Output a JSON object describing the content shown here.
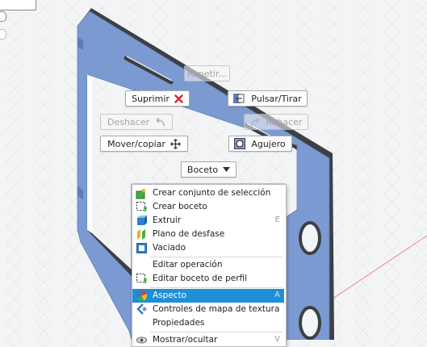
{
  "marking_menu": {
    "repeat": "Repetir...",
    "delete": "Suprimir",
    "push_pull": "Pulsar/Tirar",
    "undo": "Deshacer",
    "redo": "Rehacer",
    "move_copy": "Mover/copiar",
    "hole": "Agujero",
    "sketch": "Boceto"
  },
  "context_menu": {
    "create_selection_set": "Crear conjunto de selección",
    "create_sketch": "Crear boceto",
    "extrude": {
      "label": "Extruir",
      "shortcut": "E"
    },
    "offset_plane": "Plano de desfase",
    "shell": "Vaciado",
    "edit_feature": "Editar operación",
    "edit_profile_sketch": "Editar boceto de perfil",
    "appearance": {
      "label": "Aspecto",
      "shortcut": "A"
    },
    "texture_map_controls": "Controles de mapa de textura",
    "properties": "Propiedades",
    "show_hide": {
      "label": "Mostrar/ocultar",
      "shortcut": "V"
    }
  },
  "colors": {
    "part_face": "#7c9ad2",
    "selection_highlight": "#1f8fd6",
    "delete_red": "#e0242b"
  },
  "icons": [
    "selection-set-icon",
    "sketch-icon",
    "extrude-icon",
    "offset-plane-icon",
    "shell-icon",
    "edit-sketch-icon",
    "appearance-icon",
    "texture-map-icon",
    "delete-icon",
    "push-pull-icon",
    "undo-icon",
    "redo-icon",
    "move-icon",
    "hole-icon",
    "dropdown-arrow-icon"
  ]
}
